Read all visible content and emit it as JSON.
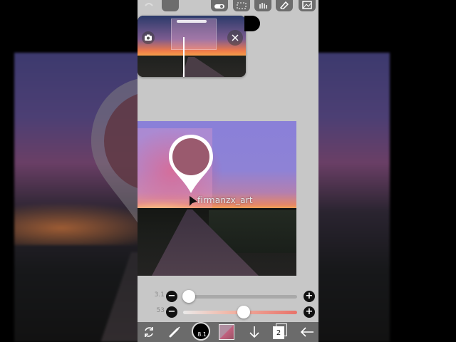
{
  "watermark": "firmanzx_art",
  "colors": {
    "picked_color": "#9a5a6e",
    "app_background": "#c7c7c7",
    "toolbar": "#6b6b6b",
    "accent_opacity": "#e8736a"
  },
  "brush_size": {
    "value": "3.1",
    "minus_label": "−",
    "plus_label": "+",
    "level": 0.05
  },
  "opacity": {
    "value": "53",
    "minus_label": "−",
    "plus_label": "+",
    "level": 0.53
  },
  "bottombar": {
    "brush_badge": "8.1",
    "layer_count": "2"
  },
  "icons": {
    "top": [
      "undo-icon",
      "redo-icon",
      "toggle-icon",
      "selection-icon",
      "hand-icon",
      "eraser-icon",
      "layer-image-icon"
    ],
    "preview": [
      "camera-icon",
      "close-icon"
    ],
    "bottom": [
      "transform-icon",
      "brush-icon",
      "brush-size-icon",
      "color-swatch-icon",
      "download-arrow-icon",
      "layers-icon",
      "back-arrow-icon"
    ]
  }
}
